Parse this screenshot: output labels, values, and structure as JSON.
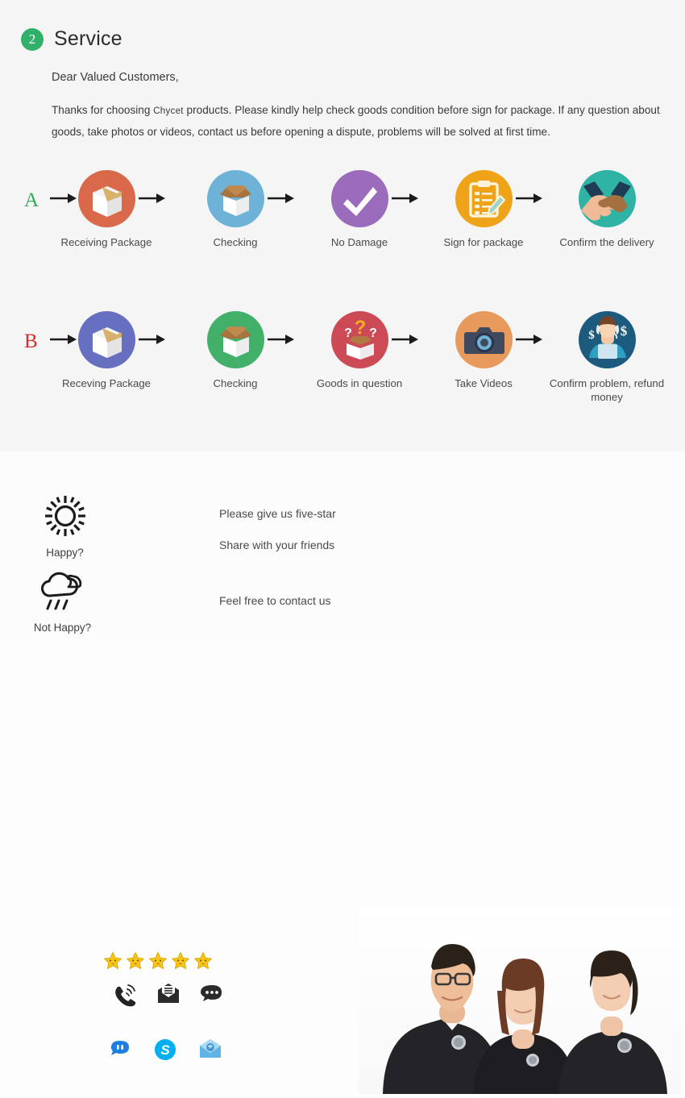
{
  "header": {
    "badge_number": "2",
    "title": "Service",
    "badge_color": "#32b06a"
  },
  "intro": {
    "salutation": "Dear Valued Customers,",
    "paragraph_before_brand": "Thanks for choosing ",
    "brand": "Chycet",
    "paragraph_after_brand": " products. Please kindly help check goods condition before sign for package. If any question about goods, take photos or videos, contact us before opening a dispute, problems will be solved at first time."
  },
  "flows": [
    {
      "letter": "A",
      "letter_color": "#2eab53",
      "steps": [
        {
          "label": "Receiving Package",
          "icon": "sealed-box-icon",
          "circle_color": "#d9694a"
        },
        {
          "label": "Checking",
          "icon": "open-box-icon",
          "circle_color": "#6fb2d8"
        },
        {
          "label": "No Damage",
          "icon": "checkmark-icon",
          "circle_color": "#9a6cbb"
        },
        {
          "label": "Sign for package",
          "icon": "clipboard-pencil-icon",
          "circle_color": "#efa318"
        },
        {
          "label": "Confirm the delivery",
          "icon": "handshake-icon",
          "circle_color": "#2eb3a5"
        }
      ]
    },
    {
      "letter": "B",
      "letter_color": "#d62b27",
      "steps": [
        {
          "label": "Receving Package",
          "icon": "sealed-box-icon",
          "circle_color": "#6770c0"
        },
        {
          "label": "Checking",
          "icon": "open-box-icon",
          "circle_color": "#43b06a"
        },
        {
          "label": "Goods in question",
          "icon": "question-box-icon",
          "circle_color": "#cc4a55"
        },
        {
          "label": "Take Videos",
          "icon": "camera-icon",
          "circle_color": "#e79a5c"
        },
        {
          "label": "Confirm problem, refund money",
          "icon": "support-agent-icon",
          "circle_color": "#1d5b7e"
        }
      ]
    }
  ],
  "contact": {
    "happy_label": "Happy?",
    "happy_icon": "sun-icon",
    "not_happy_label": "Not Happy?",
    "not_happy_icon": "rain-cloud-icon",
    "star_count": 5,
    "star_color": "#f5c518",
    "line_1": "Please give us five-star",
    "line_2": "Share with your friends",
    "line_3": "Feel free to contact us",
    "contact_icons_row1": [
      "phone-ringing-icon",
      "envelope-message-icon",
      "chat-bubble-icon"
    ],
    "contact_icons_row2": [
      "alitalk-icon",
      "skype-icon",
      "blue-envelope-icon"
    ]
  },
  "team_photo": {
    "alt": "three customer service staff in black polo shirts",
    "shirt_color": "#242428",
    "member_count": 3
  }
}
